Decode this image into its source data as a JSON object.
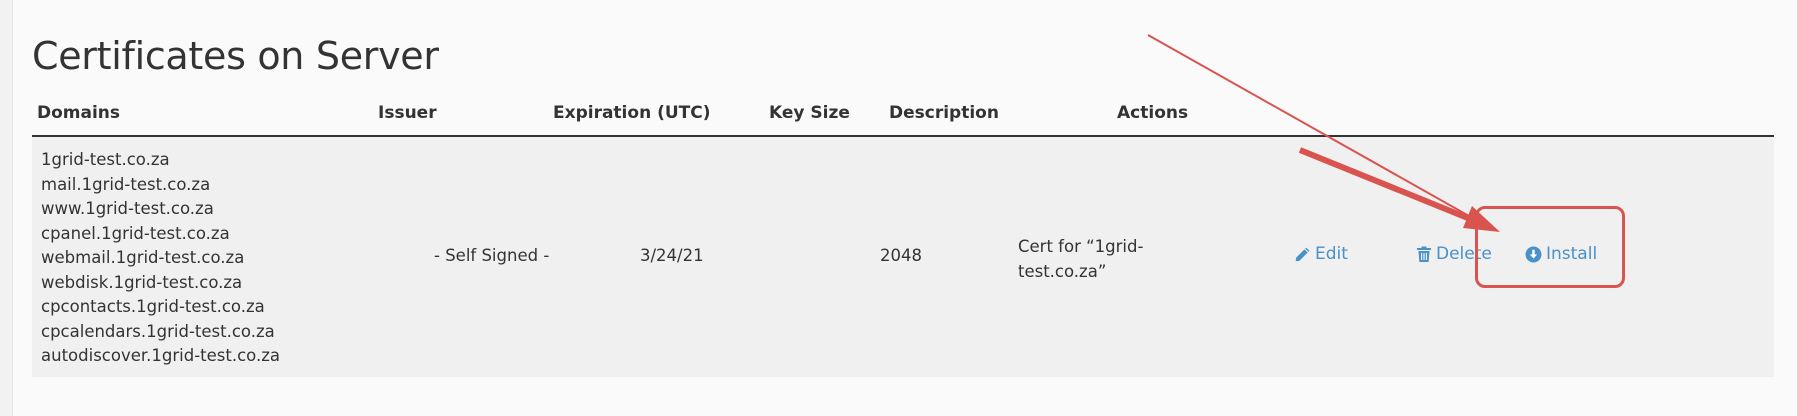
{
  "page": {
    "title": "Certificates on Server"
  },
  "table": {
    "headers": {
      "domains": "Domains",
      "issuer": "Issuer",
      "expiration": "Expiration (UTC)",
      "key_size": "Key Size",
      "description": "Description",
      "actions": "Actions"
    },
    "rows": [
      {
        "domains": [
          "1grid-test.co.za",
          "mail.1grid-test.co.za",
          "www.1grid-test.co.za",
          "cpanel.1grid-test.co.za",
          "webmail.1grid-test.co.za",
          "webdisk.1grid-test.co.za",
          "cpcontacts.1grid-test.co.za",
          "cpcalendars.1grid-test.co.za",
          "autodiscover.1grid-test.co.za"
        ],
        "issuer": "- Self Signed -",
        "expiration": "3/24/21",
        "key_size": "2048",
        "description_line1": "Cert for “1grid-",
        "description_line2": "test.co.za”",
        "actions": {
          "edit": "Edit",
          "delete": "Delete",
          "install": "Install"
        }
      }
    ]
  },
  "icons": {
    "edit": "pencil-icon",
    "delete": "trash-icon",
    "install": "circle-download-icon"
  },
  "colors": {
    "link": "#4a90c9",
    "annotation": "#d9534f",
    "row_background": "#f0f0f0"
  }
}
